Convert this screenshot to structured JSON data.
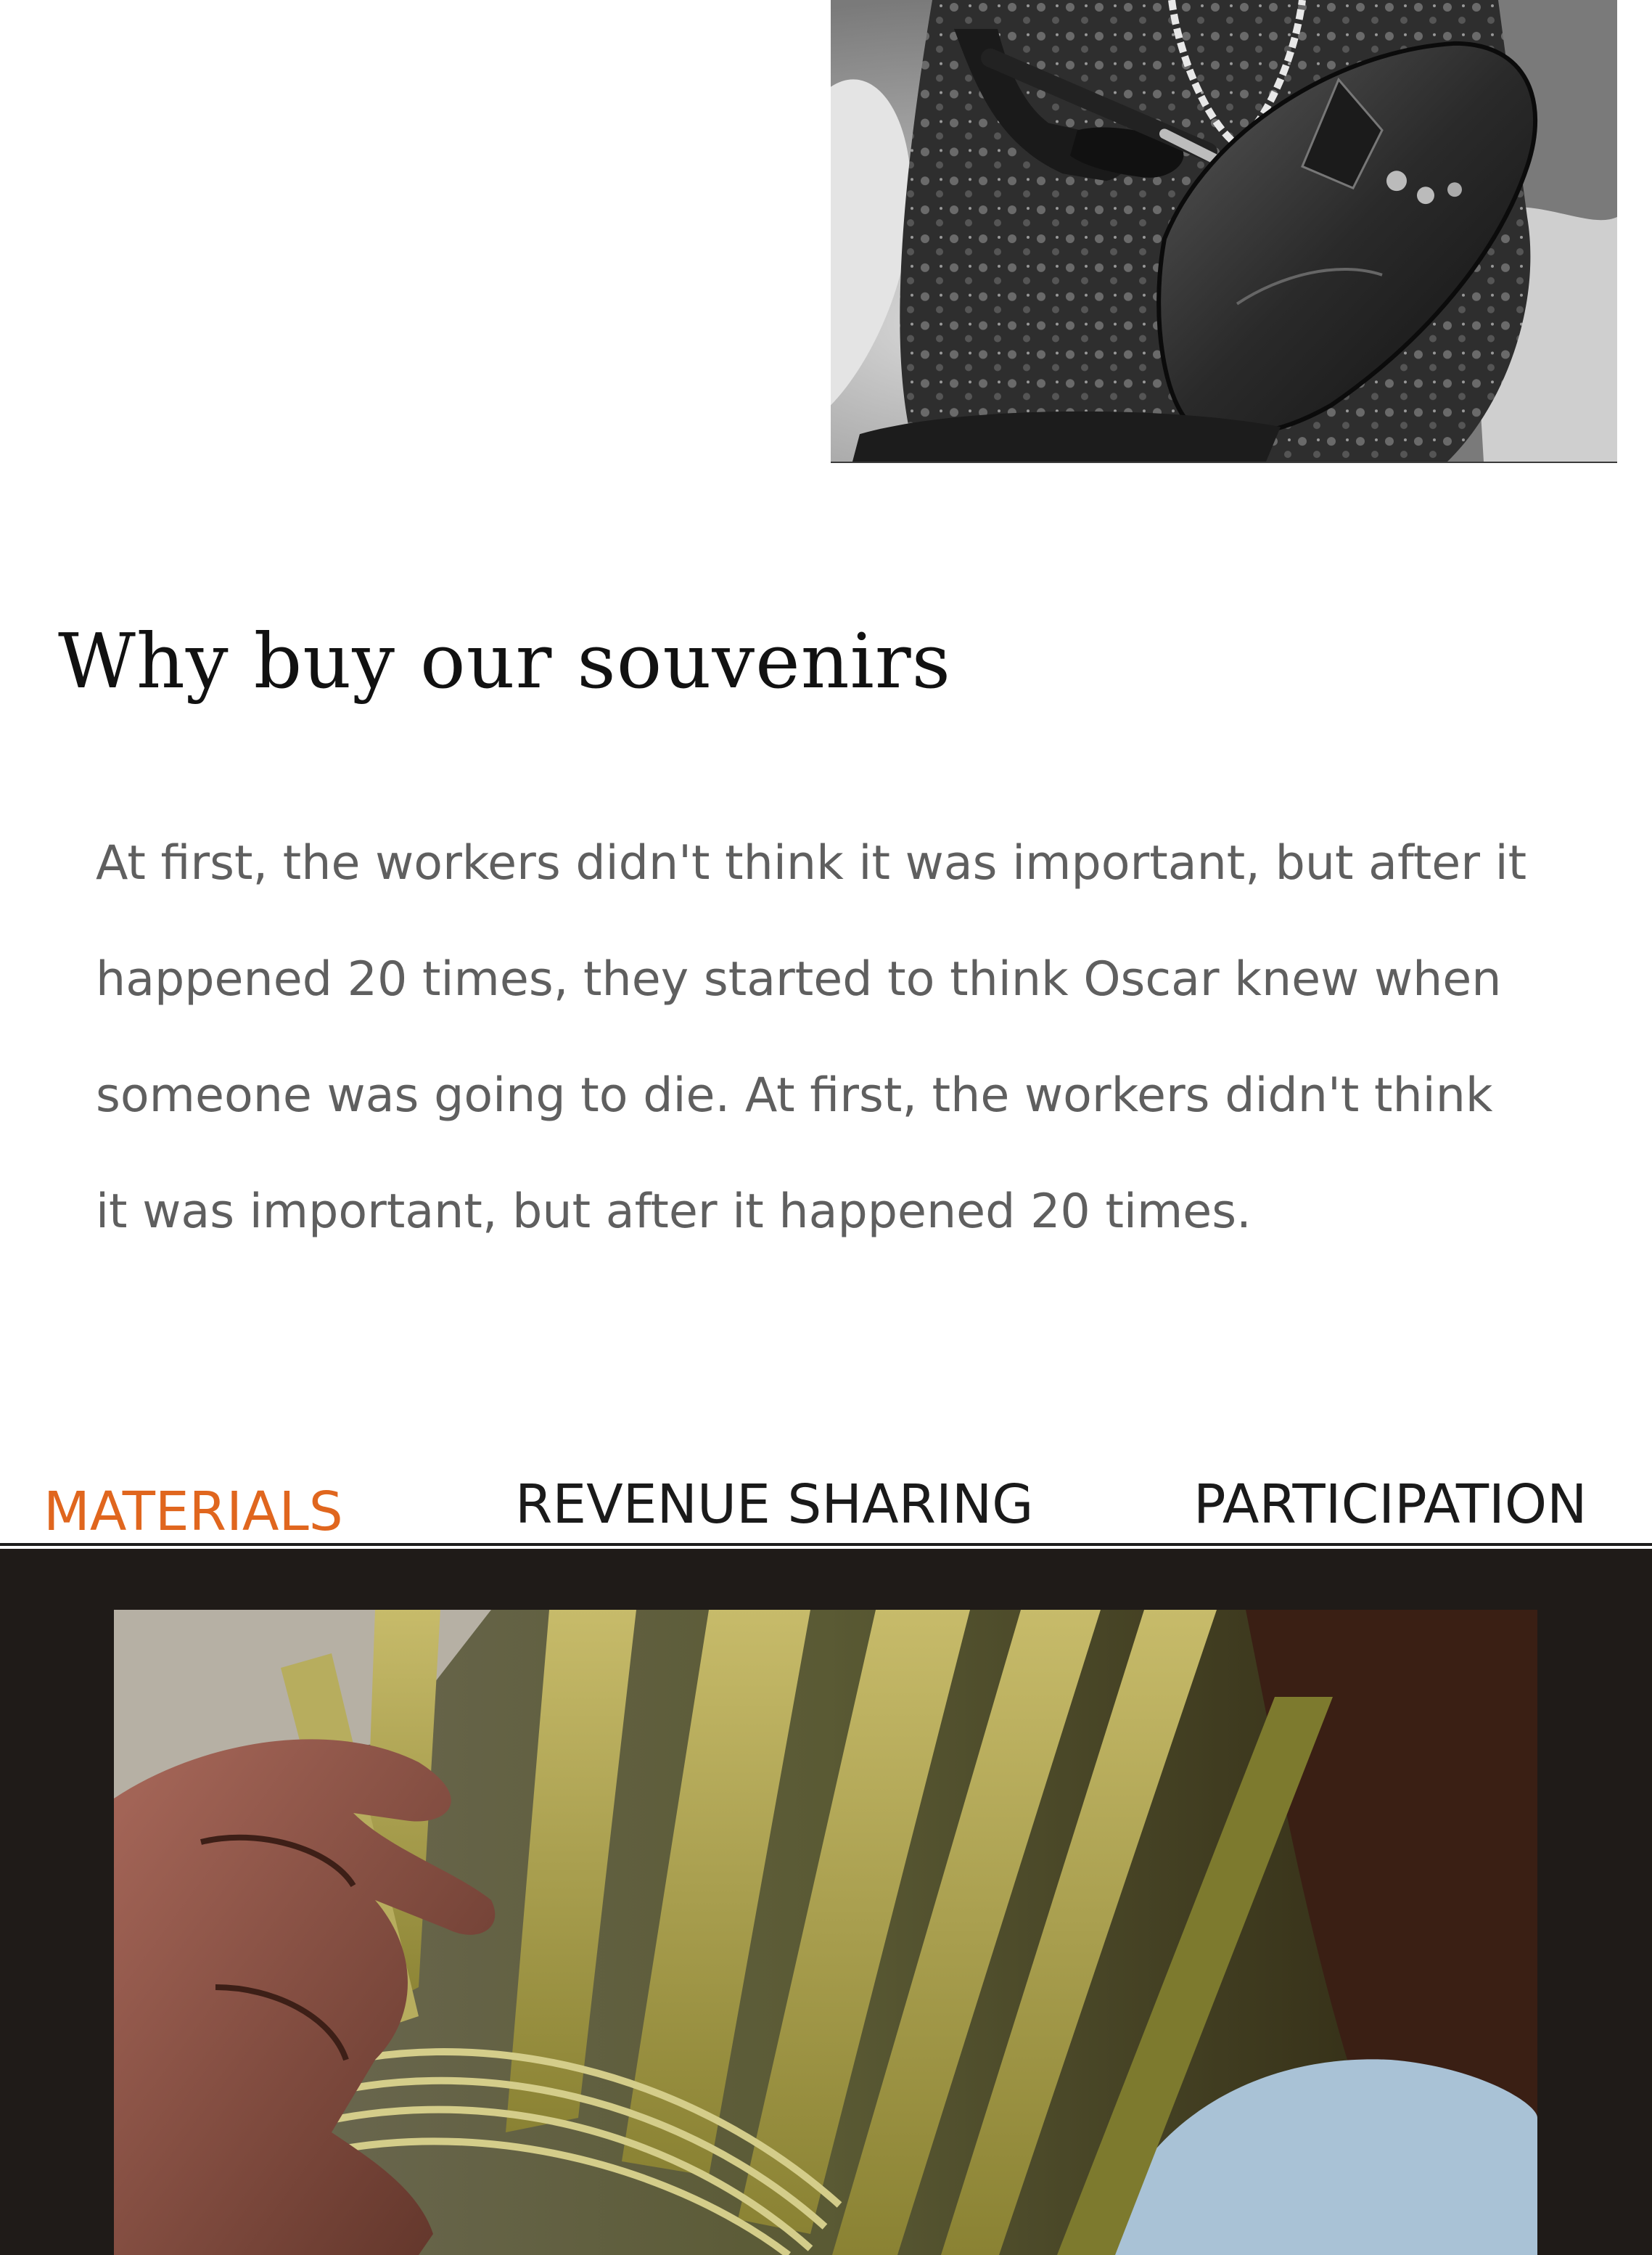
{
  "hero": {
    "image_alt": "Artisan carving a dark wooden mask (black and white photo)"
  },
  "section": {
    "title": "Why buy our souvenirs",
    "body_lines": [
      "At first, the workers didn't think it was important, but after it",
      "happened 20 times, they started to think Oscar knew when",
      "someone was going to die. At first, the workers didn't think",
      "it was important, but after it happened 20 times."
    ]
  },
  "tabs": {
    "items": [
      {
        "label": "MATERIALS",
        "active": true
      },
      {
        "label": "REVENUE SHARING",
        "active": false
      },
      {
        "label": "PARTICIPATION",
        "active": false
      }
    ],
    "active_color": "#e0661e",
    "inactive_color": "#1a1a1a"
  },
  "panel": {
    "background": "#1f1b18",
    "image_alt": "Close-up of hands weaving palm-leaf strips into a basket"
  }
}
